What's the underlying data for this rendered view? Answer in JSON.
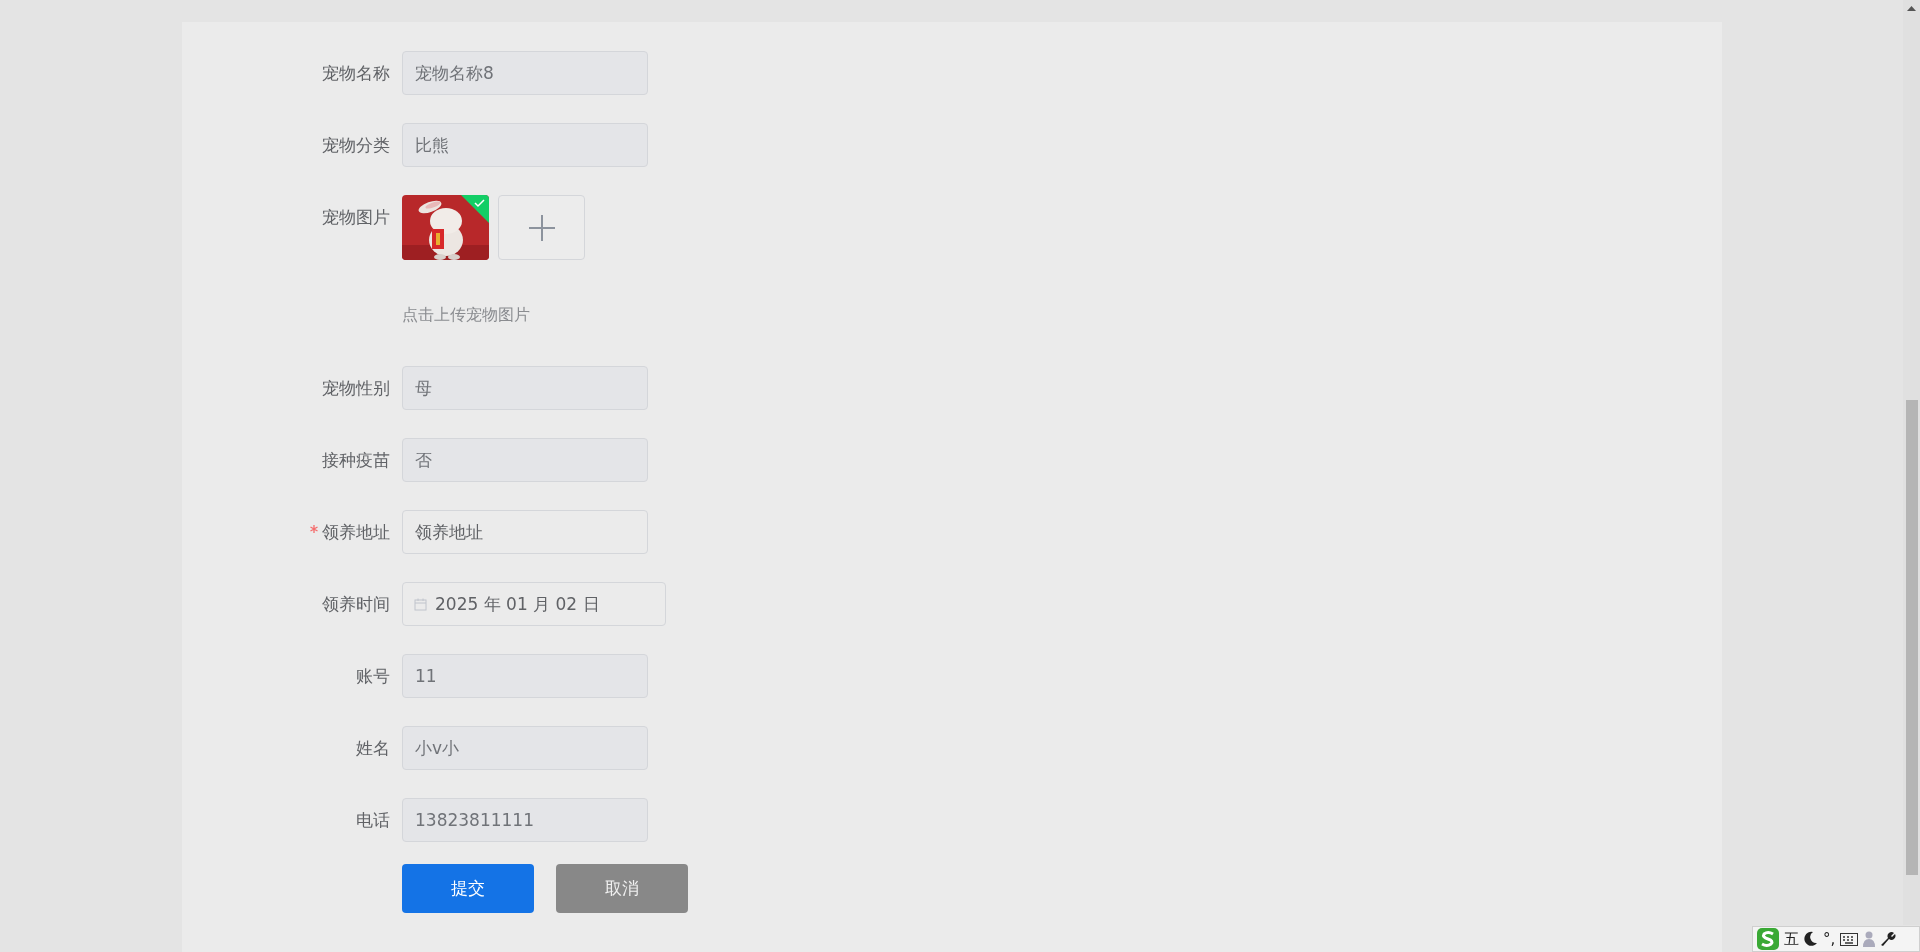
{
  "form": {
    "fields": [
      {
        "kind": "text",
        "label": "宠物名称",
        "value": "宠物名称8",
        "disabled": true,
        "required": false
      },
      {
        "kind": "text",
        "label": "宠物分类",
        "value": "比熊",
        "disabled": true,
        "required": false
      },
      {
        "label": "宠物图片",
        "uploaded": true,
        "hint": "点击上传宠物图片",
        "required": false
      },
      {
        "kind": "text",
        "label": "宠物性别",
        "value": "母",
        "disabled": true,
        "required": false
      },
      {
        "kind": "text",
        "label": "接种疫苗",
        "value": "否",
        "disabled": true,
        "required": false
      },
      {
        "kind": "text",
        "label": "领养地址",
        "value": "领养地址",
        "disabled": false,
        "required": true
      },
      {
        "kind": "date",
        "label": "领养时间",
        "value": "2025 年 01 月 02 日",
        "disabled": false,
        "required": false
      },
      {
        "kind": "text",
        "label": "账号",
        "value": "11",
        "disabled": true,
        "required": false
      },
      {
        "kind": "text",
        "label": "姓名",
        "value": "小v小",
        "disabled": true,
        "required": false
      },
      {
        "kind": "text",
        "label": "电话",
        "value": "13823811111",
        "disabled": true,
        "required": false
      }
    ],
    "buttons": [
      {
        "label": "提交",
        "kind": "primary"
      },
      {
        "label": "取消",
        "kind": "secondary"
      }
    ]
  },
  "ime_toolbar": {
    "mode": "五",
    "punctuation": "°,"
  }
}
